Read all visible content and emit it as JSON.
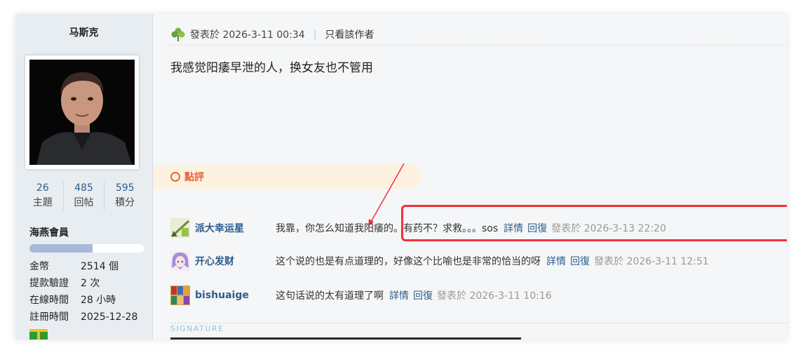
{
  "sidebar": {
    "username": "马斯克",
    "stats": [
      {
        "value": "26",
        "label": "主題"
      },
      {
        "value": "485",
        "label": "回帖"
      },
      {
        "value": "595",
        "label": "積分"
      }
    ],
    "group": "海燕會員",
    "level_progress": 0.55,
    "info": [
      {
        "label": "金幣",
        "value": "2514 個"
      },
      {
        "label": "提款驗證",
        "value": "2 次"
      },
      {
        "label": "在線時間",
        "value": "28 小時"
      },
      {
        "label": "註冊時間",
        "value": "2025-12-28"
      }
    ]
  },
  "post": {
    "icon": "clover-icon",
    "time": "發表於 2026-3-11 00:34",
    "separator": "|",
    "only_author": "只看該作者",
    "body": "我感觉阳痿早泄的人，换女友也不管用"
  },
  "rating": {
    "label": "點評"
  },
  "comments": [
    {
      "name": "派大幸运星",
      "text": "我靠，你怎么知道我阳痿的。有药不？求救。。。sos",
      "detail": "詳情",
      "reply": "回復",
      "time": "發表於 2026-3-13 22:20"
    },
    {
      "name": "开心发财",
      "text": "这个说的也是有点道理的，好像这个比喻也是非常的恰当的呀",
      "detail": "詳情",
      "reply": "回復",
      "time": "發表於 2026-3-11 12:51"
    },
    {
      "name": "bishuaige",
      "text": "这句话说的太有道理了啊",
      "detail": "詳情",
      "reply": "回復",
      "time": "發表於 2026-3-11 10:16"
    }
  ],
  "signature": {
    "label": "SIGNATURE"
  },
  "colors": {
    "link": "#2b5d8c",
    "rating_accent": "#e8643b",
    "highlight_box": "#f2313a",
    "sidebar_bg": "#e8edf1"
  }
}
